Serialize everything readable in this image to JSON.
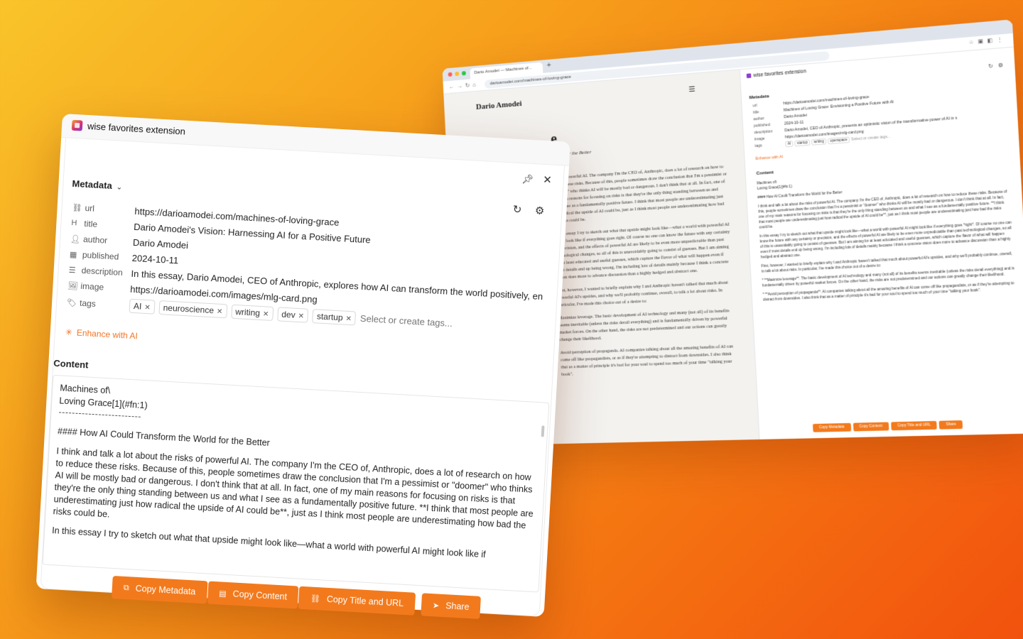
{
  "browser": {
    "tab_title": "Dario Amodei — Machines of...",
    "address": "darioamodei.com/machines-of-loving-grace",
    "page": {
      "site_name": "Dario Amodei",
      "title_fragment": "e",
      "subtitle_fragment": "World for the Better",
      "paragraphs": [
        "risks of powerful AI. The company I'm the CEO of, Anthropic, does a lot of research on how to reduce these risks. Because of this, people sometimes draw the conclusion that I'm a pessimist or \"doomer\" who thinks AI will be mostly bad or dangerous. I don't think that at all. In fact, one of my main reasons for focusing on risks is that they're the only thing standing between us and what I see as a fundamentally positive future. I think that most people are underestimating just how radical the upside of AI could be, just as I think most people are underestimating how bad the risks could be.",
        "In this essay I try to sketch out what that upside might look like—what a world with powerful AI might look like if everything goes right. Of course no one can know the future with any certainty or precision, and the effects of powerful AI are likely to be even more unpredictable than past technological changes, so all of this is unavoidably going to consist of guesses. But I am aiming for at least educated and useful guesses, which capture the flavor of what will happen even if most details end up being wrong. I'm including lots of details mainly because I think a concrete vision does more to advance discussion than a highly hedged and abstract one.",
        "First, however, I wanted to briefly explain why I and Anthropic haven't talked that much about powerful AI's upsides, and why we'll probably continue, overall, to talk a lot about risks. In particular, I've made this choice out of a desire to:",
        "Maximize leverage. The basic development of AI technology and many (not all) of its benefits seems inevitable (unless the risks derail everything) and is fundamentally driven by powerful market forces. On the other hand, the risks are not predetermined and our actions can greatly change their likelihood.",
        "Avoid perception of propaganda. AI companies talking about all the amazing benefits of AI can come off like propagandists, or as if they're attempting to distract from downsides. I also think that as a matter of principle it's bad for your soul to spend too much of your time \"talking your book\"."
      ]
    },
    "sidebar": {
      "title": "wise favorites extension",
      "meta_heading": "Metadata",
      "rows": [
        {
          "k": "url",
          "v": "https://darioamodei.com/machines-of-loving-grace"
        },
        {
          "k": "title",
          "v": "Machines of Loving Grace: Envisioning a Positive Future with AI"
        },
        {
          "k": "author",
          "v": "Dario Amodei"
        },
        {
          "k": "published",
          "v": "2024-10-11"
        },
        {
          "k": "description",
          "v": "Dario Amodei, CEO of Anthropic, presents an optimistic vision of the transformative power of AI in s"
        },
        {
          "k": "image",
          "v": "https://darioamodei.com/images/mlg-card.png"
        }
      ],
      "tags_label": "tags",
      "tags": [
        "AI",
        "startup",
        "writing",
        "openspace"
      ],
      "tags_placeholder": "Select or create tags...",
      "enhance": "Enhance with AI",
      "content_heading": "Content",
      "content_lines": [
        "Machines of\\",
        "Loving Grace[1](#fn:1)",
        "#### How AI Could Transform the World for the Better",
        "I think and talk a lot about the risks of powerful AI. The company I'm the CEO of, Anthropic, does a lot of research on how to reduce these risks. Because of this, people sometimes draw the conclusion that I'm a pessimist or \"doomer\" who thinks AI will be mostly bad or dangerous. I don't think that at all. In fact, one of my main reasons for focusing on risks is that they're the only thing standing between us and what I see as a fundamentally positive future. **I think that most people are underestimating just how radical the upside of AI could be**, just as I think most people are underestimating just how bad the risks could be.",
        "In this essay I try to sketch out what that upside might look like—what a world with powerful AI might look like if everything goes *right*. Of course no one can know the future with any certainty or precision, and the effects of powerful AI are likely to be even more unpredictable than past technological changes, so all of this is unavoidably going to consist of guesses. But I am aiming for at least educated and useful guesses, which capture the flavor of what will happen even if most details end up being wrong. I'm including lots of details mainly because I think a concrete vision does more to advance discussion than a highly hedged and abstract one.",
        "First, however, I wanted to briefly explain why I and Anthropic haven't talked that much about powerful AI's upsides, and why we'll probably continue, overall, to talk a lot about risks. In particular, I've made this choice out of a desire to:",
        "* **Maximize leverage**. The basic development of AI technology and many (not all) of its benefits seems inevitable (unless the risks derail everything) and is fundamentally driven by powerful market forces. On the other hand, the risks are not predetermined and our actions can greatly change their likelihood.",
        "* **Avoid perception of propaganda**. AI companies talking about all the amazing benefits of AI can come off like propagandists, or as if they're attempting to distract from downsides. I also think that as a matter of principle it's bad for your soul to spend too much of your time \"talking your book\"."
      ],
      "buttons": [
        "Copy Metadata",
        "Copy Content",
        "Copy Title and URL",
        "Share"
      ]
    }
  },
  "extension": {
    "title": "wise favorites extension",
    "metadata_heading": "Metadata",
    "fields": {
      "url": {
        "label": "url",
        "value": "https://darioamodei.com/machines-of-loving-grace"
      },
      "title": {
        "label": "title",
        "value": "Dario Amodei's Vision: Harnessing AI for a Positive Future"
      },
      "author": {
        "label": "author",
        "value": "Dario Amodei"
      },
      "published": {
        "label": "published",
        "value": "2024-10-11"
      },
      "description": {
        "label": "description",
        "value": "In this essay, Dario Amodei, CEO of Anthropic, explores how AI can transform the world positively, en"
      },
      "image": {
        "label": "image",
        "value": "https://darioamodei.com/images/mlg-card.png"
      },
      "tags": {
        "label": "tags",
        "placeholder": "Select or create tags..."
      }
    },
    "tags": [
      "AI",
      "neuroscience",
      "writing",
      "dev",
      "startup"
    ],
    "enhance_label": "Enhance with AI",
    "content_heading": "Content",
    "content": {
      "line1": "Machines of\\",
      "line2": "Loving Grace[1](#fn:1)",
      "rule": "-------------------------",
      "heading": "#### How AI Could Transform the World for the Better",
      "para1": "I think and talk a lot about the risks of powerful AI. The company I'm the CEO of, Anthropic, does a lot of research on how to reduce these risks. Because of this, people sometimes draw the conclusion that I'm a pessimist or \"doomer\" who thinks AI will be mostly bad or dangerous. I don't think that at all. In fact, one of my main reasons for focusing on risks is that they're the only thing standing between us and what I see as a fundamentally positive future. **I think that most people are underestimating just how radical the upside of AI could be**, just as I think most people are underestimating how bad the risks could be.",
      "para2": "In this essay I try to sketch out what that upside might look like—what a world with powerful AI might look like if"
    },
    "buttons": {
      "copy_metadata": "Copy Metadata",
      "copy_content": "Copy Content",
      "copy_title_url": "Copy Title and URL",
      "share": "Share"
    },
    "colors": {
      "accent": "#f27a1d",
      "enhance": "#f07322"
    }
  }
}
